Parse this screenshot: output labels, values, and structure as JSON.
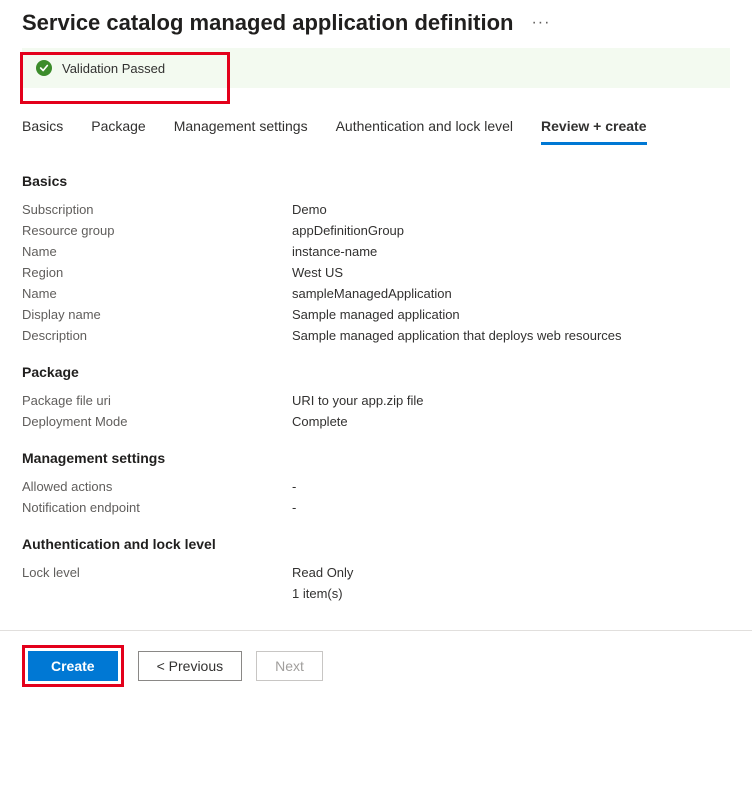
{
  "header": {
    "title": "Service catalog managed application definition",
    "more_label": "···"
  },
  "validation": {
    "message": "Validation Passed"
  },
  "tabs": [
    {
      "label": "Basics",
      "active": false
    },
    {
      "label": "Package",
      "active": false
    },
    {
      "label": "Management settings",
      "active": false
    },
    {
      "label": "Authentication and lock level",
      "active": false
    },
    {
      "label": "Review + create",
      "active": true
    }
  ],
  "sections": {
    "basics": {
      "title": "Basics",
      "rows": [
        {
          "label": "Subscription",
          "value": "Demo"
        },
        {
          "label": "Resource group",
          "value": "appDefinitionGroup"
        },
        {
          "label": "Name",
          "value": "instance-name"
        },
        {
          "label": "Region",
          "value": "West US"
        },
        {
          "label": "Name",
          "value": "sampleManagedApplication"
        },
        {
          "label": "Display name",
          "value": "Sample managed application"
        },
        {
          "label": "Description",
          "value": "Sample managed application that deploys web resources"
        }
      ]
    },
    "package": {
      "title": "Package",
      "rows": [
        {
          "label": "Package file uri",
          "value": "URI to your app.zip file"
        },
        {
          "label": "Deployment Mode",
          "value": "Complete"
        }
      ]
    },
    "management": {
      "title": "Management settings",
      "rows": [
        {
          "label": "Allowed actions",
          "value": "-"
        },
        {
          "label": "Notification endpoint",
          "value": "-"
        }
      ]
    },
    "auth": {
      "title": "Authentication and lock level",
      "rows": [
        {
          "label": "Lock level",
          "value": "Read Only"
        },
        {
          "label": "",
          "value": "1 item(s)"
        }
      ]
    }
  },
  "footer": {
    "create": "Create",
    "previous": "< Previous",
    "next": "Next"
  }
}
